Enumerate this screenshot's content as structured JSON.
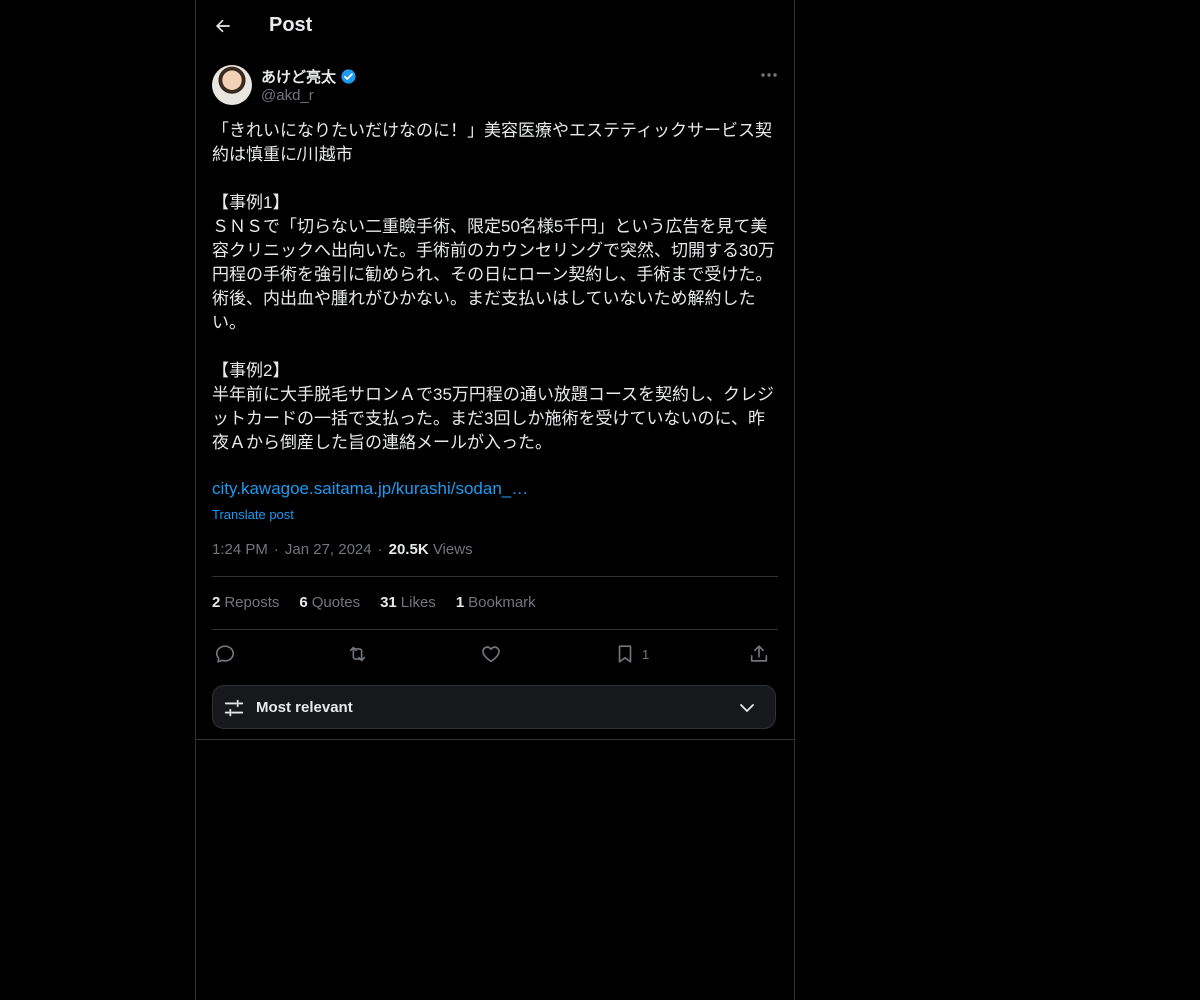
{
  "header": {
    "title": "Post"
  },
  "author": {
    "name": "あけど亮太",
    "handle": "@akd_r"
  },
  "post": {
    "text": "「きれいになりたいだけなのに！」美容医療やエステティックサービス契約は慎重に/川越市\n\n【事例1】\nＳＮＳで「切らない二重瞼手術、限定50名様5千円」という広告を見て美容クリニックへ出向いた。手術前のカウンセリングで突然、切開する30万円程の手術を強引に勧められ、その日にローン契約し、手術まで受けた。術後、内出血や腫れがひかない。まだ支払いはしていないため解約したい。\n\n【事例2】\n半年前に大手脱毛サロンＡで35万円程の通い放題コースを契約し、クレジットカードの一括で支払った。まだ3回しか施術を受けていないのに、昨夜Ａから倒産した旨の連絡メールが入った。",
    "link": "city.kawagoe.saitama.jp/kurashi/sodan_…",
    "translate_label": "Translate post",
    "time": "1:24 PM",
    "date": "Jan 27, 2024",
    "views_count": "20.5K",
    "views_label": "Views"
  },
  "stats": {
    "reposts_count": "2",
    "reposts_label": "Reposts",
    "quotes_count": "6",
    "quotes_label": "Quotes",
    "likes_count": "31",
    "likes_label": "Likes",
    "bookmarks_count": "1",
    "bookmarks_label": "Bookmark"
  },
  "actions": {
    "bookmark_count": "1"
  },
  "sort": {
    "label": "Most relevant"
  },
  "colors": {
    "accent": "#1d9bf0",
    "verified": "#1d9bf0",
    "muted": "#71767b",
    "border": "#2f3336"
  }
}
